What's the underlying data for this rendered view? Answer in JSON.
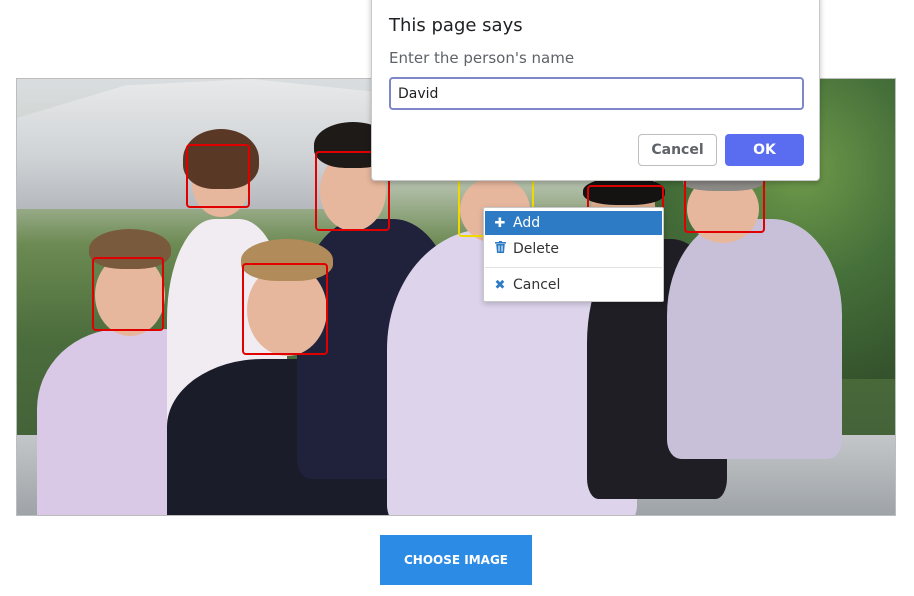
{
  "dialog": {
    "title": "This page says",
    "message": "Enter the person's name",
    "input_value": "David",
    "cancel_label": "Cancel",
    "ok_label": "OK"
  },
  "context_menu": {
    "items": [
      {
        "label": "Add",
        "icon": "plus-icon",
        "active": true
      },
      {
        "label": "Delete",
        "icon": "trash-icon",
        "active": false
      },
      {
        "label": "Cancel",
        "icon": "x-icon",
        "active": false
      }
    ]
  },
  "photo": {
    "face_boxes_count": 7,
    "selected_face_color": "#f1d900",
    "face_box_color": "#e00000"
  },
  "choose_image_label": "CHOOSE IMAGE",
  "colors": {
    "primary_button": "#2c8be4",
    "ok_button": "#5a6cf0",
    "menu_active": "#2e7bc5"
  }
}
